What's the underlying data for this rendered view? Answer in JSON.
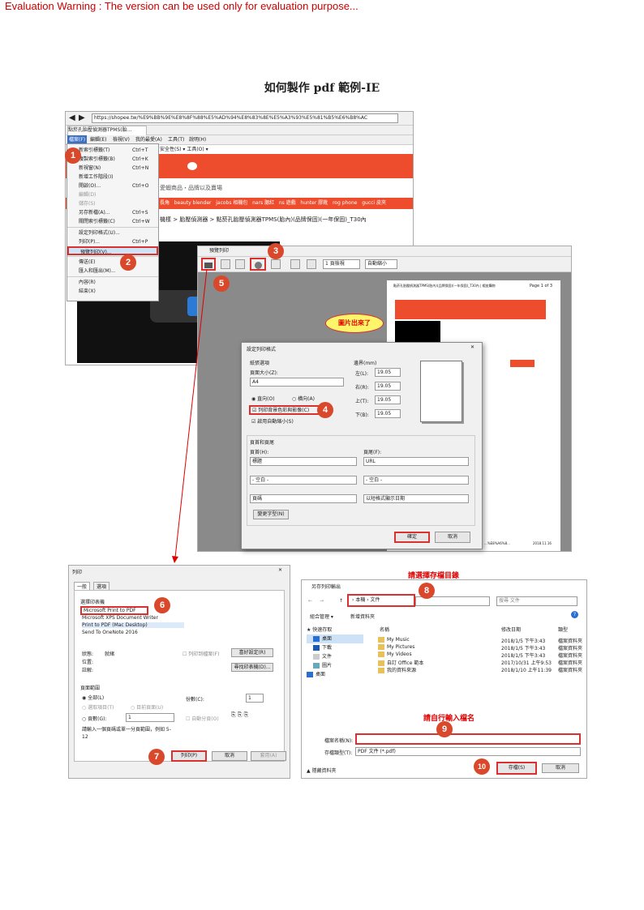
{
  "warning": "Evaluation Warning : The version can be used only for evaluation purpose...",
  "title": "如何製作 pdf 範例-IE",
  "browser": {
    "url": "https://shopee.tw/%E9%BB%9E%E8%8F%88%E5%AD%94%E8%83%8E%E5%A3%93%E5%81%B5%E6%B8%AC",
    "tab": "點菸孔胎壓偵測器TPMS(胎...",
    "menubar": [
      "檔案(F)",
      "編輯(E)",
      "檢視(V)",
      "我的最愛(A)",
      "工具(T)",
      "說明(H)"
    ],
    "toolbar2": "安全性(S) ▾  工具(O) ▾",
    "slogan": "愛蝦商品・品牌以及賣場",
    "tags": [
      "長角",
      "beauty blender",
      "jacobs 相機包",
      "nars 腮紅",
      "ns 遊戲",
      "hunter 膠靴",
      "rog phone",
      "gucci 皮夾"
    ],
    "breadcrumb": "機樣 > 胎壓偵測器 > 點菸孔胎壓偵測器TPMS(胎內)(品牌保固)(一年保固)_T30內"
  },
  "file_menu": [
    {
      "label": "新索引標籤(T)",
      "key": "Ctrl+T"
    },
    {
      "label": "複製索引標籤(B)",
      "key": "Ctrl+K"
    },
    {
      "label": "新視窗(N)",
      "key": "Ctrl+N"
    },
    {
      "label": "新增工作階段(I)",
      "key": ""
    },
    {
      "label": "開啟(O)...",
      "key": "Ctrl+O"
    },
    {
      "label": "編輯(D)",
      "key": ""
    },
    {
      "label": "儲存(S)",
      "key": ""
    },
    {
      "label": "另存新檔(A)...",
      "key": "Ctrl+S"
    },
    {
      "label": "關閉索引標籤(C)",
      "key": "Ctrl+W"
    },
    {
      "label": "設定列印格式(U)...",
      "key": ""
    },
    {
      "label": "列印(P)...",
      "key": "Ctrl+P"
    },
    {
      "label": "預覽列印(V)...",
      "key": ""
    },
    {
      "label": "傳送(E)",
      "key": ""
    },
    {
      "label": "匯入和匯出(M)...",
      "key": ""
    },
    {
      "label": "內容(R)",
      "key": ""
    },
    {
      "label": "結束(X)",
      "key": ""
    }
  ],
  "preview": {
    "title": "預覽列印",
    "page_option": "1 頁檢視",
    "zoom_option": "自動縮小",
    "callout": "圖片出來了",
    "page_header": "點菸孔胎壓偵測器TPMS(胎內)(品牌保固)(一年保固)_T30內 | 蝦皮購物",
    "page_num": "Page 1 of 3",
    "footer_url": "...%E8%A6%8...",
    "footer_date": "2018.11.16"
  },
  "page_setup": {
    "title": "設定列印格式",
    "paper_group": "紙張選項",
    "paper_size_label": "頁面大小(Z):",
    "paper_size": "A4",
    "portrait": "直向(O)",
    "landscape": "橫向(A)",
    "print_bg": "列印背景色彩與影像(C)",
    "shrink": "啟用自動縮小(S)",
    "margin_group": "邊界(mm)",
    "margins": [
      {
        "label": "左(L):",
        "value": "19.05"
      },
      {
        "label": "右(R):",
        "value": "19.05"
      },
      {
        "label": "上(T):",
        "value": "19.05"
      },
      {
        "label": "下(B):",
        "value": "19.05"
      }
    ],
    "hf_group": "頁首和頁尾",
    "header_label": "頁首(H):",
    "footer_label": "頁尾(F):",
    "header_values": [
      "標題",
      "- 空白 -",
      "頁碼"
    ],
    "footer_values": [
      "URL",
      "- 空白 -",
      "以短格式顯示日期"
    ],
    "font_button": "變更字型(N)",
    "ok": "確定",
    "cancel": "取消"
  },
  "print_dialog": {
    "title": "列印",
    "tabs": [
      "一般",
      "選項"
    ],
    "select_printer": "選擇印表機",
    "printers": [
      "Microsoft Print to PDF",
      "Microsoft XPS Document Writer",
      "Print to PDF (Mac Desktop)",
      "Send To OneNote 2016"
    ],
    "status_label": "狀態:",
    "status_value": "就緒",
    "location_label": "位置:",
    "comment_label": "註解:",
    "print_to_file": "列印到檔案(F)",
    "preferences": "喜好設定(R)",
    "find_printer": "尋找印表機(D)...",
    "range_group": "頁面範圍",
    "all": "全部(L)",
    "selection": "選取項目(T)",
    "current": "目前頁面(U)",
    "pages": "頁數(G):",
    "pages_value": "1",
    "hint": "請輸入一個頁碼或單一分頁範圍，例如 5-12",
    "copies_label": "份數(C):",
    "copies_value": "1",
    "collate": "自動分頁(O)",
    "print_button": "列印(P)",
    "cancel_button": "取消",
    "apply_button": "套用(A)"
  },
  "save_dialog": {
    "title": "另存列印輸出",
    "annotation_top": "請選擇存檔目錄",
    "path": [
      "本機",
      "文件"
    ],
    "search_placeholder": "搜尋 文件",
    "organize": "組合管理 ▾",
    "new_folder": "新增資料夾",
    "quick_access": "快速存取",
    "sidebar": [
      "桌面",
      "下載",
      "文件",
      "圖片",
      "桌面"
    ],
    "col_name": "名稱",
    "col_date": "修改日期",
    "col_type": "類型",
    "files": [
      {
        "name": "My Music",
        "date": "2018/1/5 下午3:43",
        "type": "檔案資料夾"
      },
      {
        "name": "My Pictures",
        "date": "2018/1/5 下午3:43",
        "type": "檔案資料夾"
      },
      {
        "name": "My Videos",
        "date": "2018/1/5 下午3:43",
        "type": "檔案資料夾"
      },
      {
        "name": "自訂 Office 範本",
        "date": "2017/10/31 上午9:53",
        "type": "檔案資料夾"
      },
      {
        "name": "我的資料來源",
        "date": "2018/1/10 上午11:39",
        "type": "檔案資料夾"
      }
    ],
    "annotation_name": "請自行輸入檔名",
    "filename_label": "檔案名稱(N):",
    "filetype_label": "存檔類型(T):",
    "filetype_value": "PDF 文件 (*.pdf)",
    "hide_folders": "隱藏資料夾",
    "save_button": "存檔(S)",
    "cancel_button": "取消"
  },
  "steps": [
    "1",
    "2",
    "3",
    "4",
    "5",
    "6",
    "7",
    "8",
    "9",
    "10"
  ],
  "colors": {
    "accent": "#ee4d2d",
    "annotation": "#d9482b",
    "warning": "#cc0000"
  }
}
